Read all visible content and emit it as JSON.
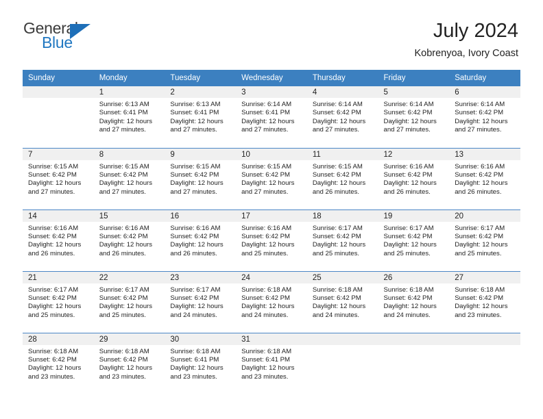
{
  "brand": {
    "name_part1": "General",
    "name_part2": "Blue",
    "logo_icon": "blue-triangle-icon"
  },
  "header": {
    "title": "July 2024",
    "subtitle": "Kobrenyoa, Ivory Coast"
  },
  "calendar": {
    "weekday_headers": [
      "Sunday",
      "Monday",
      "Tuesday",
      "Wednesday",
      "Thursday",
      "Friday",
      "Saturday"
    ],
    "colors": {
      "header_blue": "#3c80c0",
      "daynum_gray": "#f0f0f0",
      "row_rule_blue": "#4a86c5",
      "brand_blue": "#2077c1"
    },
    "weeks": [
      [
        {
          "day": "",
          "lines": []
        },
        {
          "day": "1",
          "lines": [
            "Sunrise: 6:13 AM",
            "Sunset: 6:41 PM",
            "Daylight: 12 hours",
            "and 27 minutes."
          ]
        },
        {
          "day": "2",
          "lines": [
            "Sunrise: 6:13 AM",
            "Sunset: 6:41 PM",
            "Daylight: 12 hours",
            "and 27 minutes."
          ]
        },
        {
          "day": "3",
          "lines": [
            "Sunrise: 6:14 AM",
            "Sunset: 6:41 PM",
            "Daylight: 12 hours",
            "and 27 minutes."
          ]
        },
        {
          "day": "4",
          "lines": [
            "Sunrise: 6:14 AM",
            "Sunset: 6:42 PM",
            "Daylight: 12 hours",
            "and 27 minutes."
          ]
        },
        {
          "day": "5",
          "lines": [
            "Sunrise: 6:14 AM",
            "Sunset: 6:42 PM",
            "Daylight: 12 hours",
            "and 27 minutes."
          ]
        },
        {
          "day": "6",
          "lines": [
            "Sunrise: 6:14 AM",
            "Sunset: 6:42 PM",
            "Daylight: 12 hours",
            "and 27 minutes."
          ]
        }
      ],
      [
        {
          "day": "7",
          "lines": [
            "Sunrise: 6:15 AM",
            "Sunset: 6:42 PM",
            "Daylight: 12 hours",
            "and 27 minutes."
          ]
        },
        {
          "day": "8",
          "lines": [
            "Sunrise: 6:15 AM",
            "Sunset: 6:42 PM",
            "Daylight: 12 hours",
            "and 27 minutes."
          ]
        },
        {
          "day": "9",
          "lines": [
            "Sunrise: 6:15 AM",
            "Sunset: 6:42 PM",
            "Daylight: 12 hours",
            "and 27 minutes."
          ]
        },
        {
          "day": "10",
          "lines": [
            "Sunrise: 6:15 AM",
            "Sunset: 6:42 PM",
            "Daylight: 12 hours",
            "and 27 minutes."
          ]
        },
        {
          "day": "11",
          "lines": [
            "Sunrise: 6:15 AM",
            "Sunset: 6:42 PM",
            "Daylight: 12 hours",
            "and 26 minutes."
          ]
        },
        {
          "day": "12",
          "lines": [
            "Sunrise: 6:16 AM",
            "Sunset: 6:42 PM",
            "Daylight: 12 hours",
            "and 26 minutes."
          ]
        },
        {
          "day": "13",
          "lines": [
            "Sunrise: 6:16 AM",
            "Sunset: 6:42 PM",
            "Daylight: 12 hours",
            "and 26 minutes."
          ]
        }
      ],
      [
        {
          "day": "14",
          "lines": [
            "Sunrise: 6:16 AM",
            "Sunset: 6:42 PM",
            "Daylight: 12 hours",
            "and 26 minutes."
          ]
        },
        {
          "day": "15",
          "lines": [
            "Sunrise: 6:16 AM",
            "Sunset: 6:42 PM",
            "Daylight: 12 hours",
            "and 26 minutes."
          ]
        },
        {
          "day": "16",
          "lines": [
            "Sunrise: 6:16 AM",
            "Sunset: 6:42 PM",
            "Daylight: 12 hours",
            "and 26 minutes."
          ]
        },
        {
          "day": "17",
          "lines": [
            "Sunrise: 6:16 AM",
            "Sunset: 6:42 PM",
            "Daylight: 12 hours",
            "and 25 minutes."
          ]
        },
        {
          "day": "18",
          "lines": [
            "Sunrise: 6:17 AM",
            "Sunset: 6:42 PM",
            "Daylight: 12 hours",
            "and 25 minutes."
          ]
        },
        {
          "day": "19",
          "lines": [
            "Sunrise: 6:17 AM",
            "Sunset: 6:42 PM",
            "Daylight: 12 hours",
            "and 25 minutes."
          ]
        },
        {
          "day": "20",
          "lines": [
            "Sunrise: 6:17 AM",
            "Sunset: 6:42 PM",
            "Daylight: 12 hours",
            "and 25 minutes."
          ]
        }
      ],
      [
        {
          "day": "21",
          "lines": [
            "Sunrise: 6:17 AM",
            "Sunset: 6:42 PM",
            "Daylight: 12 hours",
            "and 25 minutes."
          ]
        },
        {
          "day": "22",
          "lines": [
            "Sunrise: 6:17 AM",
            "Sunset: 6:42 PM",
            "Daylight: 12 hours",
            "and 25 minutes."
          ]
        },
        {
          "day": "23",
          "lines": [
            "Sunrise: 6:17 AM",
            "Sunset: 6:42 PM",
            "Daylight: 12 hours",
            "and 24 minutes."
          ]
        },
        {
          "day": "24",
          "lines": [
            "Sunrise: 6:18 AM",
            "Sunset: 6:42 PM",
            "Daylight: 12 hours",
            "and 24 minutes."
          ]
        },
        {
          "day": "25",
          "lines": [
            "Sunrise: 6:18 AM",
            "Sunset: 6:42 PM",
            "Daylight: 12 hours",
            "and 24 minutes."
          ]
        },
        {
          "day": "26",
          "lines": [
            "Sunrise: 6:18 AM",
            "Sunset: 6:42 PM",
            "Daylight: 12 hours",
            "and 24 minutes."
          ]
        },
        {
          "day": "27",
          "lines": [
            "Sunrise: 6:18 AM",
            "Sunset: 6:42 PM",
            "Daylight: 12 hours",
            "and 23 minutes."
          ]
        }
      ],
      [
        {
          "day": "28",
          "lines": [
            "Sunrise: 6:18 AM",
            "Sunset: 6:42 PM",
            "Daylight: 12 hours",
            "and 23 minutes."
          ]
        },
        {
          "day": "29",
          "lines": [
            "Sunrise: 6:18 AM",
            "Sunset: 6:42 PM",
            "Daylight: 12 hours",
            "and 23 minutes."
          ]
        },
        {
          "day": "30",
          "lines": [
            "Sunrise: 6:18 AM",
            "Sunset: 6:41 PM",
            "Daylight: 12 hours",
            "and 23 minutes."
          ]
        },
        {
          "day": "31",
          "lines": [
            "Sunrise: 6:18 AM",
            "Sunset: 6:41 PM",
            "Daylight: 12 hours",
            "and 23 minutes."
          ]
        },
        {
          "day": "",
          "lines": []
        },
        {
          "day": "",
          "lines": []
        },
        {
          "day": "",
          "lines": []
        }
      ]
    ]
  }
}
